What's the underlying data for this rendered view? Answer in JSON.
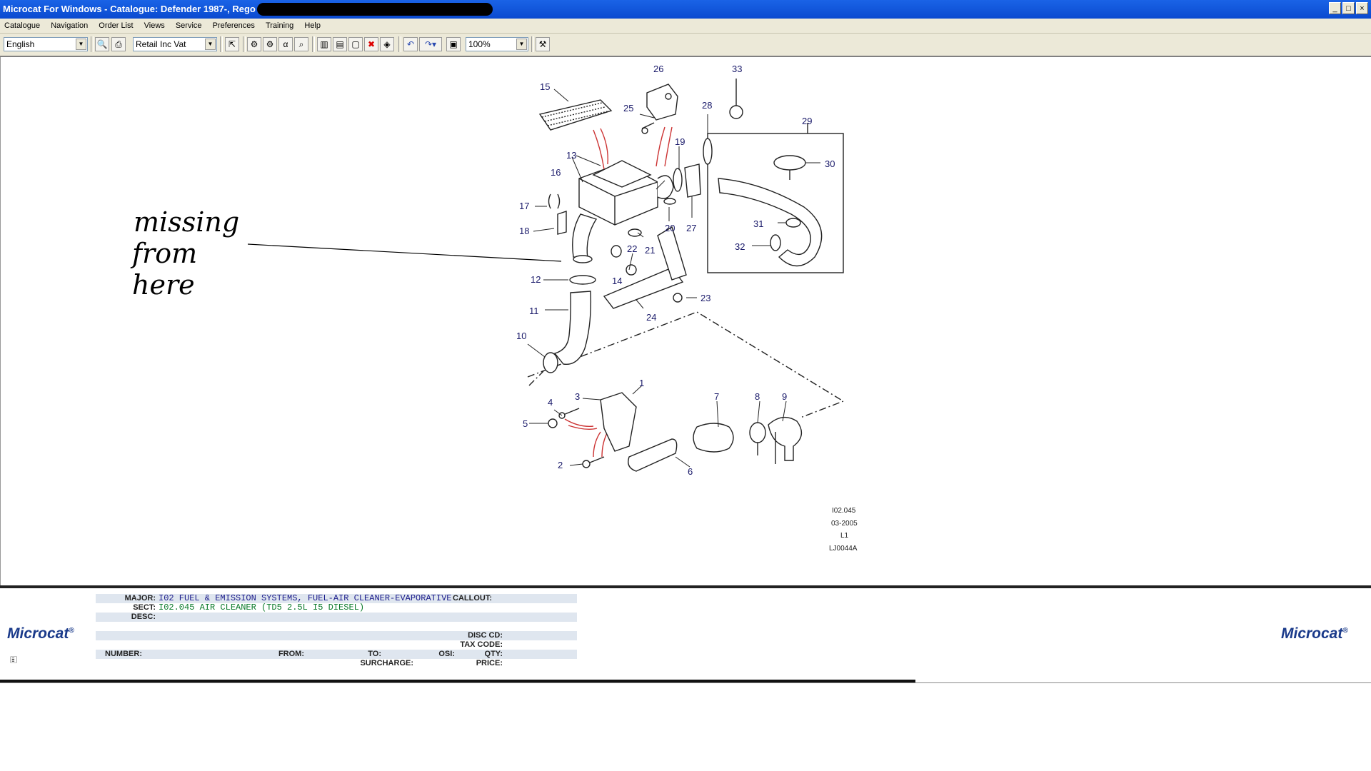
{
  "window": {
    "title": "Microcat For Windows - Catalogue: Defender 1987-, Rego"
  },
  "menu": [
    "Catalogue",
    "Navigation",
    "Order List",
    "Views",
    "Service",
    "Preferences",
    "Training",
    "Help"
  ],
  "toolbar": {
    "language": "English",
    "price_type": "Retail Inc Vat",
    "zoom": "100%",
    "icons": [
      "print-preview-icon",
      "print-icon",
      "select-icon",
      "parts-icon",
      "order-icon",
      "alpha-search-icon",
      "search-icon",
      "split-icon",
      "split-alt-icon",
      "display-icon",
      "close-red-icon",
      "book-icon",
      "undo-icon",
      "redo-icon",
      "notes-icon",
      "tools-icon"
    ]
  },
  "diagram": {
    "callouts": [
      "1",
      "2",
      "3",
      "4",
      "5",
      "6",
      "7",
      "8",
      "9",
      "10",
      "11",
      "12",
      "13",
      "14",
      "15",
      "16",
      "17",
      "18",
      "19",
      "20",
      "21",
      "22",
      "23",
      "24",
      "25",
      "26",
      "27",
      "28",
      "29",
      "30",
      "31",
      "32",
      "33"
    ],
    "meta": [
      "I02.045",
      "03-2005",
      "L1",
      "LJ0044A"
    ],
    "annotation": [
      "missing",
      "from",
      "here"
    ]
  },
  "info": {
    "logo": "Microcat",
    "major_label": "MAJOR:",
    "major_value": "I02  FUEL & EMISSION SYSTEMS, FUEL-AIR CLEANER-EVAPORATIVE",
    "callout_label": "CALLOUT:",
    "sect_label": "SECT:",
    "sect_value": "I02.045   AIR CLEANER (TD5 2.5L I5 DIESEL)",
    "desc_label": "DESC:",
    "disc_label": "DISC CD:",
    "tax_label": "TAX CODE:",
    "number_label": "NUMBER:",
    "from_label": "FROM:",
    "to_label": "TO:",
    "osi_label": "OSI:",
    "qty_label": "QTY:",
    "surcharge_label": "SURCHARGE:",
    "price_label": "PRICE:"
  }
}
